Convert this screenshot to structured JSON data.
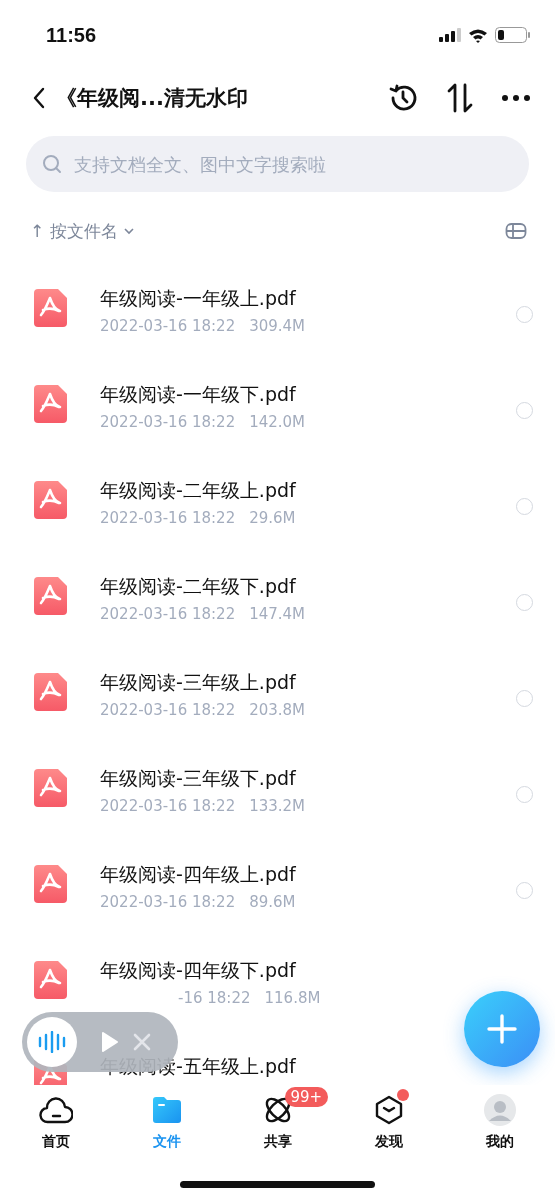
{
  "status_bar": {
    "time": "11:56"
  },
  "header": {
    "title": "《年级阅...清无水印"
  },
  "search": {
    "placeholder": "支持文档全文、图中文字搜索啦"
  },
  "sort": {
    "arrow": "↑",
    "label": "按文件名"
  },
  "files": [
    {
      "name": "年级阅读-一年级上.pdf",
      "date": "2022-03-16 18:22",
      "size": "309.4M",
      "selected": false
    },
    {
      "name": "年级阅读-一年级下.pdf",
      "date": "2022-03-16 18:22",
      "size": "142.0M",
      "selected": false
    },
    {
      "name": "年级阅读-二年级上.pdf",
      "date": "2022-03-16 18:22",
      "size": "29.6M",
      "selected": false
    },
    {
      "name": "年级阅读-二年级下.pdf",
      "date": "2022-03-16 18:22",
      "size": "147.4M",
      "selected": false
    },
    {
      "name": "年级阅读-三年级上.pdf",
      "date": "2022-03-16 18:22",
      "size": "203.8M",
      "selected": false
    },
    {
      "name": "年级阅读-三年级下.pdf",
      "date": "2022-03-16 18:22",
      "size": "133.2M",
      "selected": false
    },
    {
      "name": "年级阅读-四年级上.pdf",
      "date": "2022-03-16 18:22",
      "size": "89.6M",
      "selected": false
    },
    {
      "name": "年级阅读-四年级下.pdf",
      "date": "-16 18:22",
      "size": "116.8M",
      "covered": true
    },
    {
      "name": "年级阅读-五年级上.pdf"
    }
  ],
  "tabs": [
    {
      "kind": "home",
      "label": "首页",
      "selected": false
    },
    {
      "kind": "files",
      "label": "文件",
      "selected": true
    },
    {
      "kind": "share",
      "label": "共享",
      "selected": false,
      "badge": "99+"
    },
    {
      "kind": "discover",
      "label": "发现",
      "selected": false,
      "dot": true
    },
    {
      "kind": "me",
      "label": "我的",
      "selected": false
    }
  ]
}
